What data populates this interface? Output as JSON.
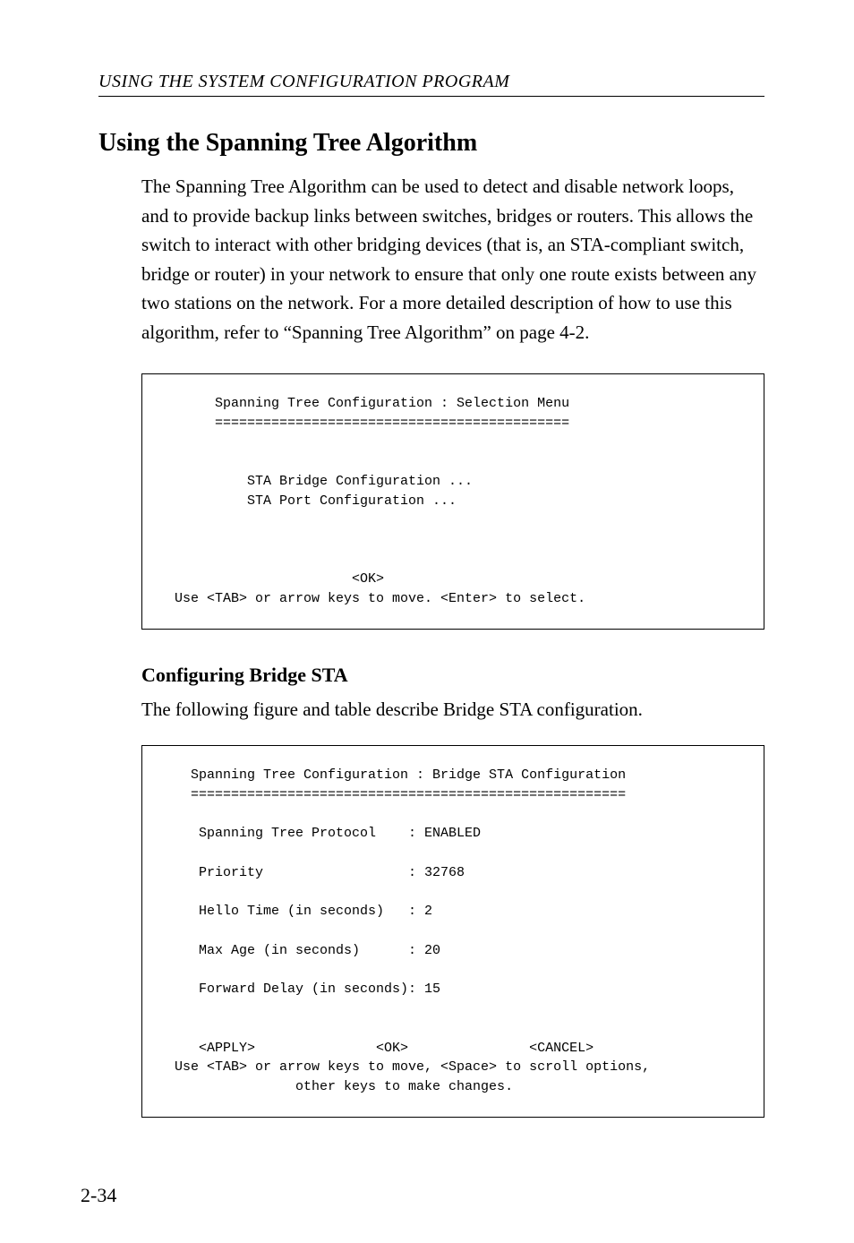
{
  "running_head": "USING THE SYSTEM CONFIGURATION PROGRAM",
  "section_title": "Using the Spanning Tree Algorithm",
  "section_body": "The Spanning Tree Algorithm can be used to detect and disable network loops, and to provide backup links between switches, bridges or routers. This allows the switch to interact with other bridging devices (that is, an STA-compliant switch, bridge or router) in your network to ensure that only one route exists between any two stations on the network. For a more detailed description of how to use this algorithm, refer to “Spanning Tree Algorithm” on page 4-2.",
  "terminal1": "       Spanning Tree Configuration : Selection Menu\n       ============================================\n\n\n           STA Bridge Configuration ...\n           STA Port Configuration ...\n\n\n\n                        <OK>\n  Use <TAB> or arrow keys to move. <Enter> to select.",
  "subsection_title": "Configuring Bridge STA",
  "subsection_body": "The following figure and table describe Bridge STA configuration.",
  "terminal2": "    Spanning Tree Configuration : Bridge STA Configuration\n    ======================================================\n\n     Spanning Tree Protocol    : ENABLED\n\n     Priority                  : 32768\n\n     Hello Time (in seconds)   : 2\n\n     Max Age (in seconds)      : 20\n\n     Forward Delay (in seconds): 15\n\n\n     <APPLY>               <OK>               <CANCEL>\n  Use <TAB> or arrow keys to move, <Space> to scroll options,\n                 other keys to make changes.",
  "page_number": "2-34",
  "chart_data": {
    "type": "table",
    "title": "Bridge STA Configuration Values",
    "rows": [
      {
        "label": "Spanning Tree Protocol",
        "value": "ENABLED"
      },
      {
        "label": "Priority",
        "value": "32768"
      },
      {
        "label": "Hello Time (in seconds)",
        "value": "2"
      },
      {
        "label": "Max Age (in seconds)",
        "value": "20"
      },
      {
        "label": "Forward Delay (in seconds)",
        "value": "15"
      }
    ]
  }
}
